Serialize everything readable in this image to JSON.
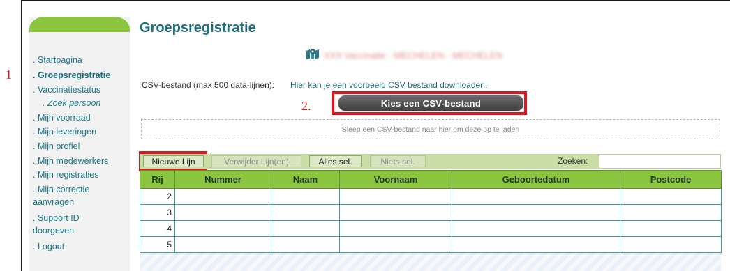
{
  "annotations": {
    "step1": "1",
    "step2": "2."
  },
  "sidebar": {
    "items": [
      {
        "label": ". Startpagina",
        "active": false
      },
      {
        "label": ". Groepsregistratie",
        "active": true
      },
      {
        "label": ". Vaccinatiestatus",
        "active": false
      },
      {
        "label": ". Zoek persoon",
        "active": false,
        "sub": true
      },
      {
        "label": ". Mijn voorraad",
        "active": false
      },
      {
        "label": ". Mijn leveringen",
        "active": false
      },
      {
        "label": ". Mijn profiel",
        "active": false
      },
      {
        "label": ". Mijn medewerkers",
        "active": false
      },
      {
        "label": ". Mijn registraties",
        "active": false
      },
      {
        "label": ". Mijn correctie",
        "continuation": "aanvragen",
        "active": false
      },
      {
        "label": ". Support ID",
        "continuation": "doorgeven",
        "active": false
      },
      {
        "label": ". Logout",
        "active": false
      }
    ]
  },
  "main": {
    "title": "Groepsregistratie",
    "location": "XXX Vaccinatie - MECHELEN - MECHELEN",
    "csv_label": "CSV-bestand (max 500 data-lijnen):",
    "csv_example_link": "Hier kan je een voorbeeld CSV bestand downloaden.",
    "upload_button": "Kies een CSV-bestand",
    "dropzone_text": "Sleep een CSV-bestand naar hier om deze op te laden"
  },
  "toolbar": {
    "new_line": "Nieuwe Lijn",
    "delete_lines": "Verwijder Lijn(en)",
    "select_all": "Alles sel.",
    "select_none": "Niets sel.",
    "search_label": "Zoeken:",
    "search_value": ""
  },
  "table": {
    "columns": [
      "Rij",
      "Nummer",
      "Naam",
      "Voornaam",
      "Geboortedatum",
      "Postcode"
    ],
    "rows": [
      [
        "2",
        "",
        "",
        "",
        "",
        ""
      ],
      [
        "3",
        "",
        "",
        "",
        "",
        ""
      ],
      [
        "4",
        "",
        "",
        "",
        "",
        ""
      ],
      [
        "5",
        "",
        "",
        "",
        "",
        ""
      ]
    ]
  },
  "colors": {
    "accent": "#8bc53f",
    "teal": "#1f6e7d",
    "annotation": "#e3141b"
  }
}
